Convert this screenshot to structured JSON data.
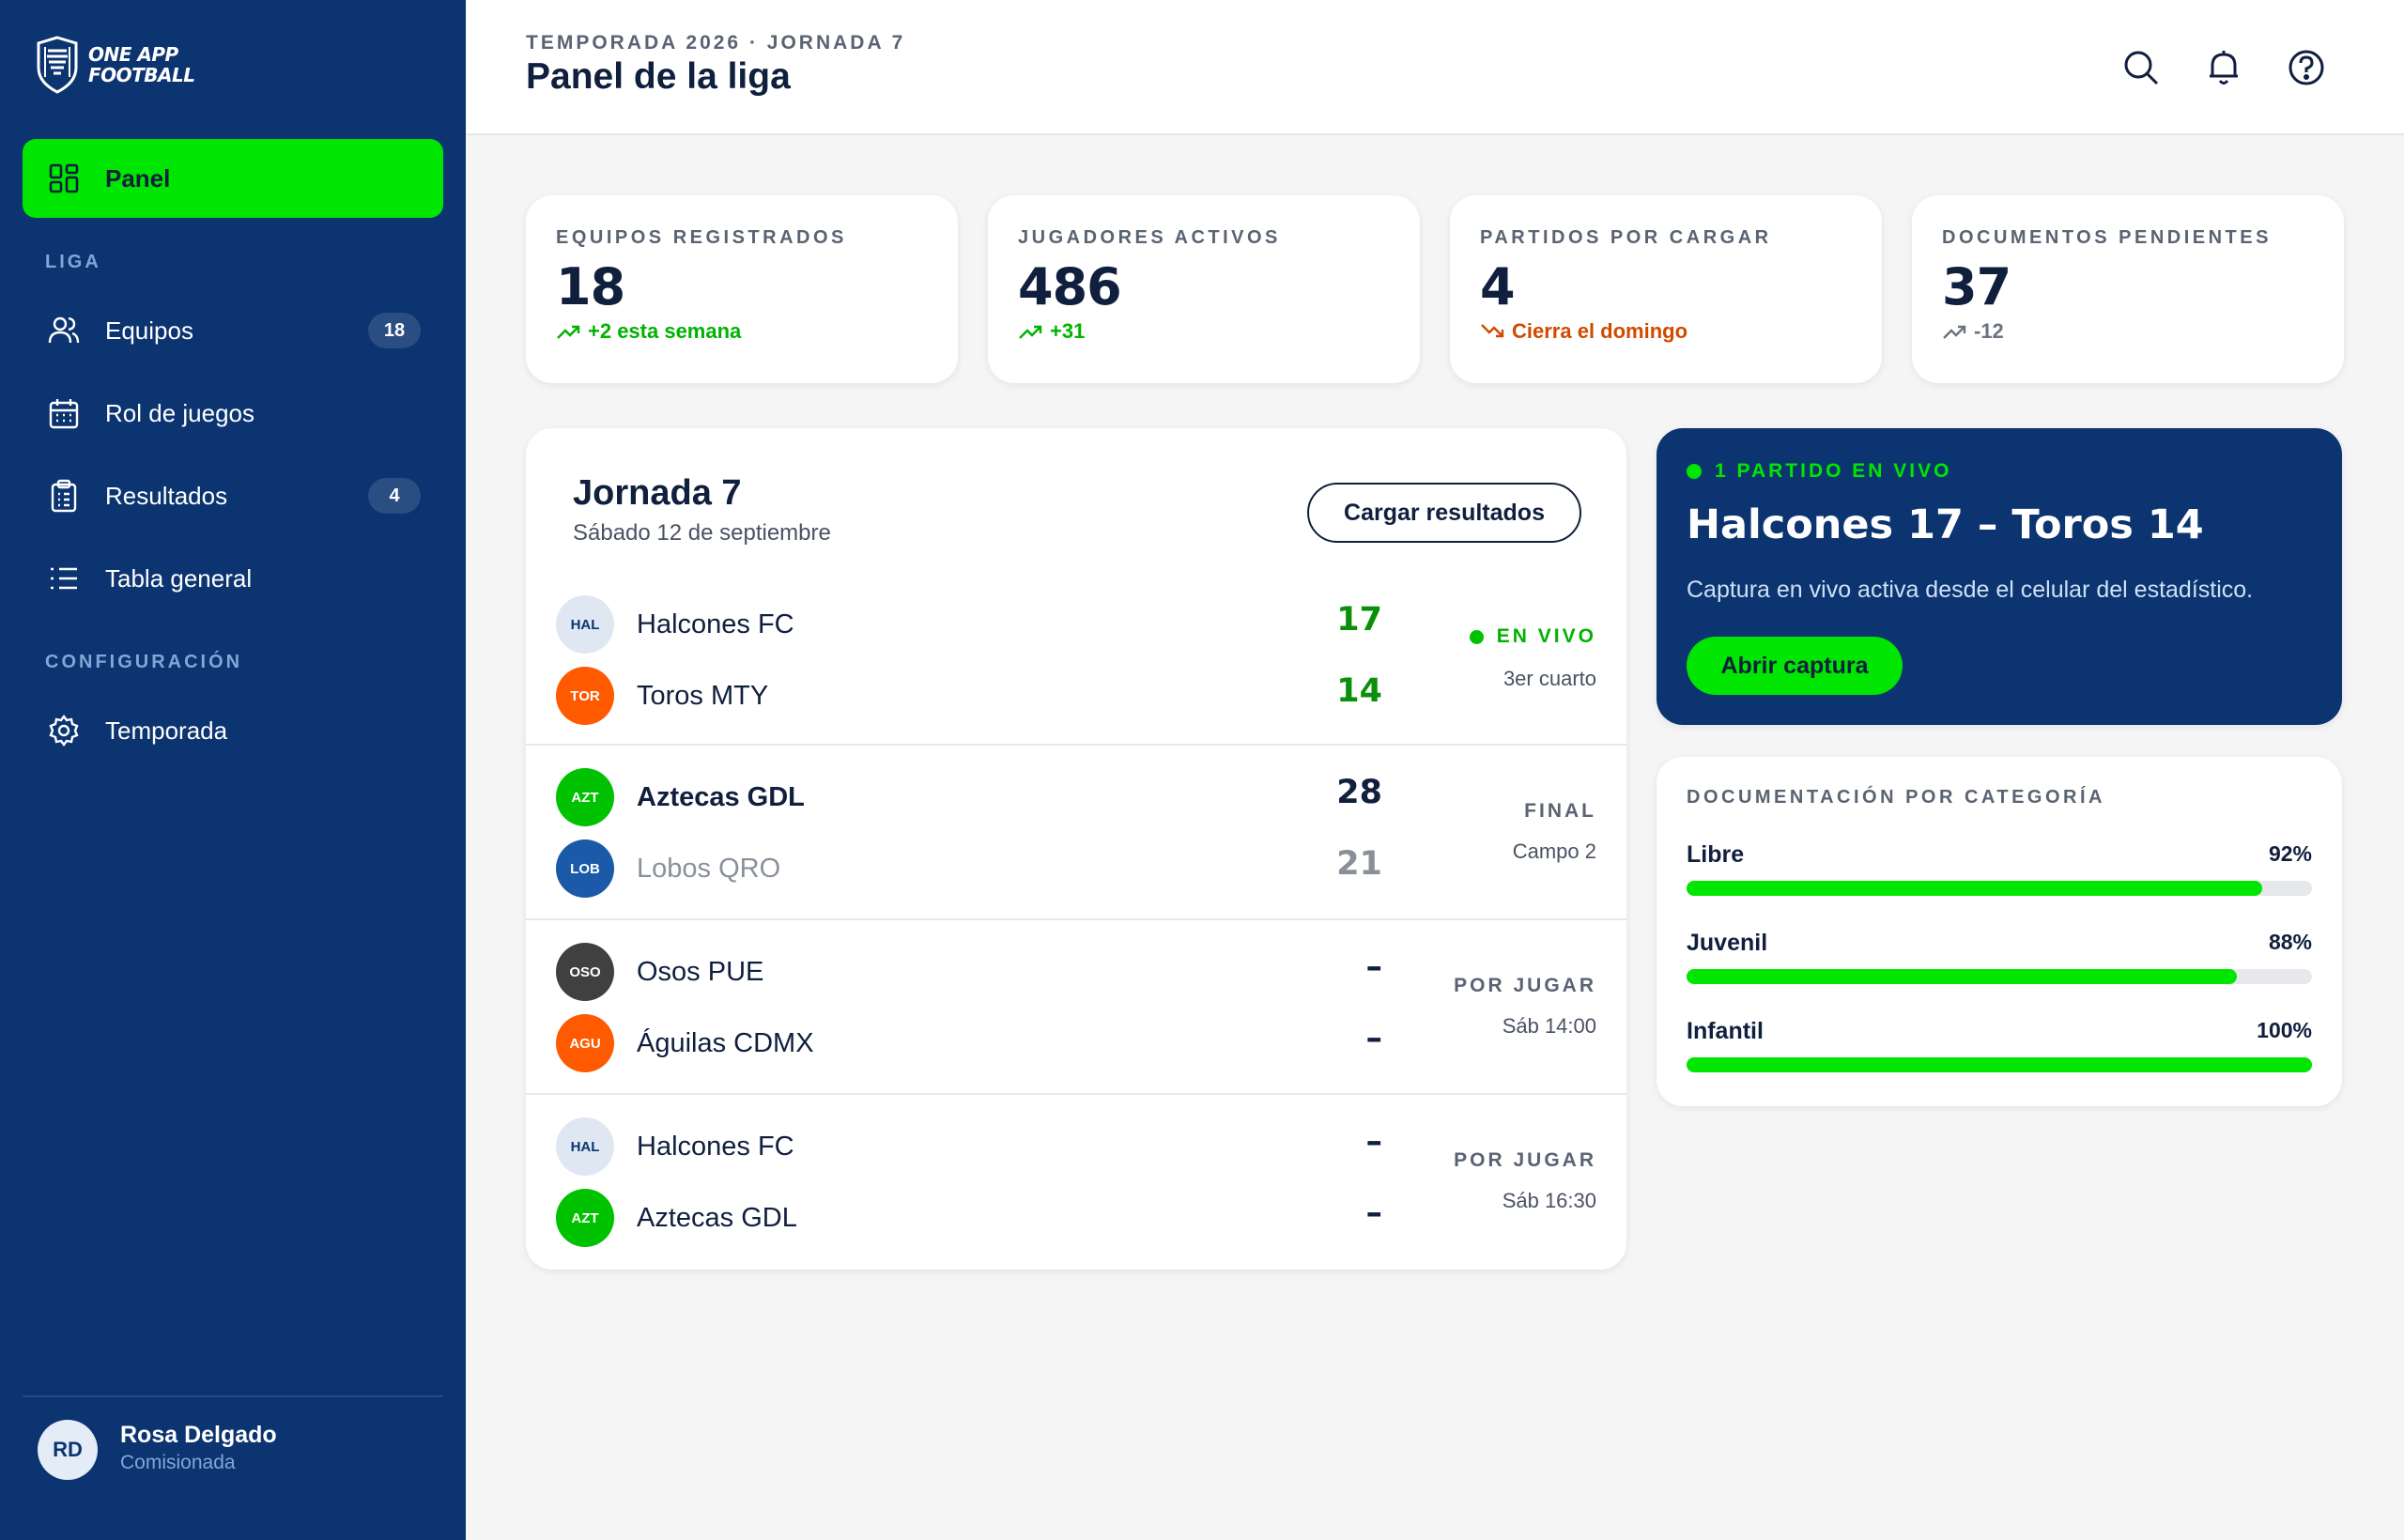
{
  "sidebar": {
    "brand": {
      "line1": "ONE APP",
      "line2": "FOOTBALL"
    },
    "nav_active": {
      "label": "Panel"
    },
    "section_liga": "LIGA",
    "items": [
      {
        "label": "Equipos",
        "badge": "18"
      },
      {
        "label": "Rol de juegos"
      },
      {
        "label": "Resultados",
        "badge": "4"
      },
      {
        "label": "Tabla general"
      }
    ],
    "section_config": "CONFIGURACIÓN",
    "config_items": [
      {
        "label": "Temporada"
      }
    ],
    "user": {
      "initials": "RD",
      "name": "Rosa Delgado",
      "role": "Comisionada"
    }
  },
  "header": {
    "supertitle": "TEMPORADA 2026 · JORNADA 7",
    "title": "Panel de la liga",
    "icons": [
      "search-icon",
      "bell-icon",
      "help-icon"
    ]
  },
  "stats": [
    {
      "label": "EQUIPOS REGISTRADOS",
      "value": "18",
      "delta": "+2 esta semana",
      "trend": "up",
      "color": "#00b300"
    },
    {
      "label": "JUGADORES ACTIVOS",
      "value": "486",
      "delta": "+31",
      "trend": "up",
      "color": "#00b300"
    },
    {
      "label": "PARTIDOS POR CARGAR",
      "value": "4",
      "delta": "Cierra el domingo",
      "trend": "down",
      "color": "#d14a00"
    },
    {
      "label": "DOCUMENTOS PENDIENTES",
      "value": "37",
      "delta": "-12",
      "trend": "up",
      "color": "#6b7280"
    }
  ],
  "matches_card": {
    "title": "Jornada 7",
    "subtitle": "Sábado 12 de septiembre",
    "button": "Cargar resultados",
    "matches": [
      {
        "home": {
          "abbr": "HAL",
          "name": "Halcones FC",
          "score": "17"
        },
        "away": {
          "abbr": "TOR",
          "name": "Toros MTY",
          "score": "14"
        },
        "status": "EN VIVO",
        "detail": "3er cuarto"
      },
      {
        "home": {
          "abbr": "AZT",
          "name": "Aztecas GDL",
          "score": "28"
        },
        "away": {
          "abbr": "LOB",
          "name": "Lobos QRO",
          "score": "21"
        },
        "status": "FINAL",
        "detail": "Campo 2"
      },
      {
        "home": {
          "abbr": "OSO",
          "name": "Osos PUE",
          "score": "–"
        },
        "away": {
          "abbr": "AGU",
          "name": "Águilas CDMX",
          "score": "–"
        },
        "status": "POR JUGAR",
        "detail": "Sáb 14:00"
      },
      {
        "home": {
          "abbr": "HAL",
          "name": "Halcones FC",
          "score": "–"
        },
        "away": {
          "abbr": "AZT",
          "name": "Aztecas GDL",
          "score": "–"
        },
        "status": "POR JUGAR",
        "detail": "Sáb 16:30"
      }
    ]
  },
  "live_card": {
    "tag": "1 PARTIDO EN VIVO",
    "title": "Halcones 17 – Toros 14",
    "description": "Captura en vivo activa desde el celular del estadístico.",
    "button": "Abrir captura"
  },
  "docs_card": {
    "title": "DOCUMENTACIÓN POR CATEGORÍA",
    "rows": [
      {
        "name": "Libre",
        "pct_label": "92%",
        "value": 0.92
      },
      {
        "name": "Juvenil",
        "pct_label": "88%",
        "value": 0.88
      },
      {
        "name": "Infantil",
        "pct_label": "100%",
        "value": 1.0
      }
    ]
  },
  "colors": {
    "primary": "#0b3470",
    "accent": "#00e600",
    "live": "#00c200",
    "warn": "#d14a00"
  }
}
